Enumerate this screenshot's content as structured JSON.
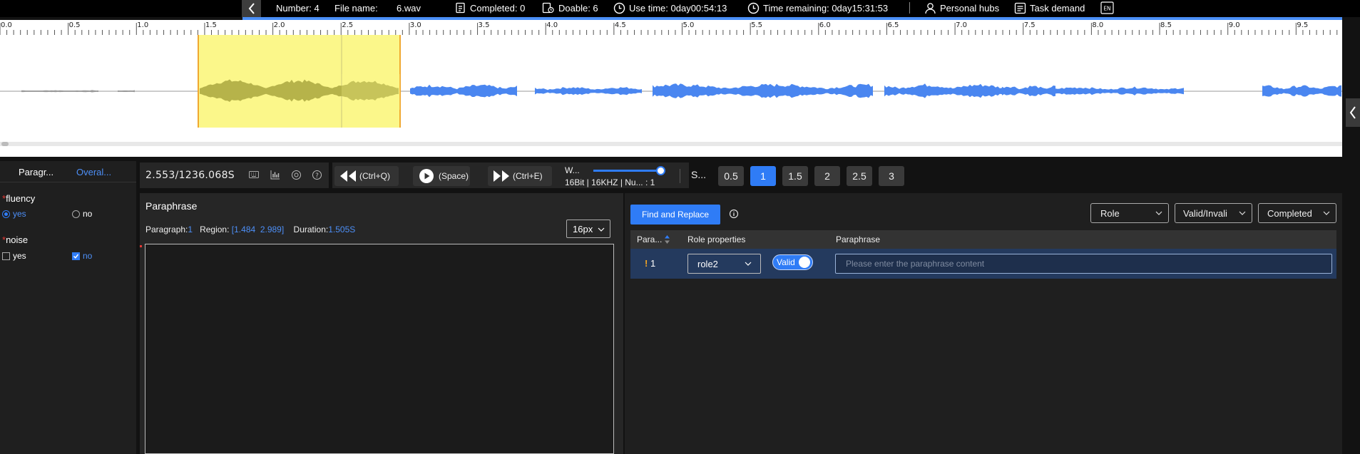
{
  "topbar": {
    "number_label": "Number: 4",
    "file_label": "File name:",
    "file_value": "6.wav",
    "completed": "Completed: 0",
    "doable": "Doable: 6",
    "use_time": "Use time: 0day00:54:13",
    "time_remaining": "Time remaining: 0day15:31:53",
    "personal_hubs": "Personal hubs",
    "task_demand": "Task demand",
    "lang": "EN"
  },
  "ruler": {
    "labels": [
      "0.0",
      "0.5",
      "1.0",
      "1.5",
      "2.0",
      "2.5",
      "3.0",
      "3.5",
      "4.0",
      "4.5",
      "5.0",
      "5.5",
      "6.0",
      "6.5",
      "7.0",
      "7.5",
      "8.0",
      "8.5",
      "9.0",
      "9.5"
    ]
  },
  "left_panel": {
    "tab_paragraph": "Paragr...",
    "tab_overall": "Overal...",
    "fluency_label": "fluency",
    "noise_label": "noise",
    "yes": "yes",
    "no": "no",
    "fluency_selected": "yes",
    "noise_selected": "no"
  },
  "controls": {
    "time": "2.553/1236.068S",
    "rewind_label": "(Ctrl+Q)",
    "play_label": "(Space)",
    "forward_label": "(Ctrl+E)",
    "w_label": "W...",
    "audio_info": "16Bit | 16KHZ | Nu... : 1",
    "s_label": "S...",
    "speeds": [
      "0.5",
      "1",
      "1.5",
      "2",
      "2.5",
      "3"
    ],
    "active_speed": "1"
  },
  "paraphrase_panel": {
    "title": "Paraphrase",
    "paragraph_label": "Paragraph:",
    "paragraph_value": "1",
    "region_label": "Region:",
    "region_value": "[1.484  2.989]",
    "duration_label": "Duration:",
    "duration_value": "1.505S",
    "font_size": "16px"
  },
  "right_panel": {
    "find_replace": "Find and Replace",
    "filter_role": "Role",
    "filter_valid": "Valid/Invali",
    "filter_completed": "Completed",
    "col_para": "Para...",
    "col_role": "Role properties",
    "col_paraphrase": "Paraphrase",
    "rows": [
      {
        "index": "1",
        "role": "role2",
        "valid": "Valid",
        "placeholder": "Please enter the paraphrase content"
      }
    ]
  },
  "colors": {
    "accent": "#2f7cf6",
    "waveform": "#4a86f0",
    "selection": "#fbf78a",
    "selection_border": "#f0a830",
    "row_highlight": "#243a5e"
  }
}
